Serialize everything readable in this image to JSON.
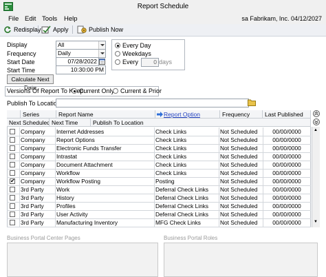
{
  "window": {
    "title": "Report Schedule",
    "company": "sa  Fabrikam, Inc.  04/12/2027"
  },
  "menu": [
    "File",
    "Edit",
    "Tools",
    "Help"
  ],
  "toolbar": {
    "redisplay": "Redisplay",
    "apply": "Apply",
    "publish_now": "Publish Now"
  },
  "filters": {
    "display_label": "Display",
    "display_value": "All",
    "frequency_label": "Frequency",
    "frequency_value": "Daily",
    "start_date_label": "Start Date",
    "start_date_value": "07/28/2022",
    "start_time_label": "Start Time",
    "start_time_value": "10:30:00 PM",
    "calc_button": "Calculate Next Date"
  },
  "recurrence": {
    "every_day": "Every Day",
    "weekdays": "Weekdays",
    "every": "Every",
    "every_value": "0",
    "days": "days",
    "selected": "Every Day"
  },
  "versions": {
    "label": "Versions Of Report To Keep:",
    "current_only": "Current Only",
    "current_prior": "Current & Prior",
    "selected": "Current Only"
  },
  "publish": {
    "label": "Publish To Location",
    "value": ""
  },
  "grid": {
    "headers1": {
      "series": "Series",
      "report_name": "Report Name",
      "report_option": "Report Option",
      "frequency": "Frequency",
      "last_published": "Last Published"
    },
    "headers2": {
      "next_scheduled": "Next Scheduled",
      "next_time": "Next Time",
      "publish_to": "Publish To Location"
    },
    "rows": [
      {
        "checked": false,
        "series": "Company",
        "name": "Internet Addresses",
        "option": "Check Links",
        "frequency": "Not Scheduled",
        "last": "00/00/0000"
      },
      {
        "checked": false,
        "series": "Company",
        "name": "Report Options",
        "option": "Check Links",
        "frequency": "Not Scheduled",
        "last": "00/00/0000"
      },
      {
        "checked": false,
        "series": "Company",
        "name": "Electronic Funds Transfer",
        "option": "Check Links",
        "frequency": "Not Scheduled",
        "last": "00/00/0000"
      },
      {
        "checked": false,
        "series": "Company",
        "name": "Intrastat",
        "option": "Check Links",
        "frequency": "Not Scheduled",
        "last": "00/00/0000"
      },
      {
        "checked": false,
        "series": "Company",
        "name": "Document Attachment",
        "option": "Check Links",
        "frequency": "Not Scheduled",
        "last": "00/00/0000"
      },
      {
        "checked": false,
        "series": "Company",
        "name": "Workflow",
        "option": "Check Links",
        "frequency": "Not Scheduled",
        "last": "00/00/0000"
      },
      {
        "checked": true,
        "series": "Company",
        "name": "Workflow Posting",
        "option": "Posting",
        "frequency": "Not Scheduled",
        "last": "00/00/0000"
      },
      {
        "checked": false,
        "series": "3rd Party",
        "name": "Work",
        "option": "Deferral Check Links",
        "frequency": "Not Scheduled",
        "last": "00/00/0000"
      },
      {
        "checked": false,
        "series": "3rd Party",
        "name": "History",
        "option": "Deferral Check Links",
        "frequency": "Not Scheduled",
        "last": "00/00/0000"
      },
      {
        "checked": false,
        "series": "3rd Party",
        "name": "Profiles",
        "option": "Deferral Check Links",
        "frequency": "Not Scheduled",
        "last": "00/00/0000"
      },
      {
        "checked": false,
        "series": "3rd Party",
        "name": "User Activity",
        "option": "Deferral Check Links",
        "frequency": "Not Scheduled",
        "last": "00/00/0000"
      },
      {
        "checked": false,
        "series": "3rd Party",
        "name": "Manufacturing Inventory",
        "option": "MFG Check Links",
        "frequency": "Not Scheduled",
        "last": "00/00/0000"
      }
    ]
  },
  "panels": {
    "left": "Business Portal Center Pages",
    "right": "Business Portal Roles"
  },
  "colors": {
    "link": "#1f3fbf",
    "accent_arrow": "#2f6fd8"
  }
}
